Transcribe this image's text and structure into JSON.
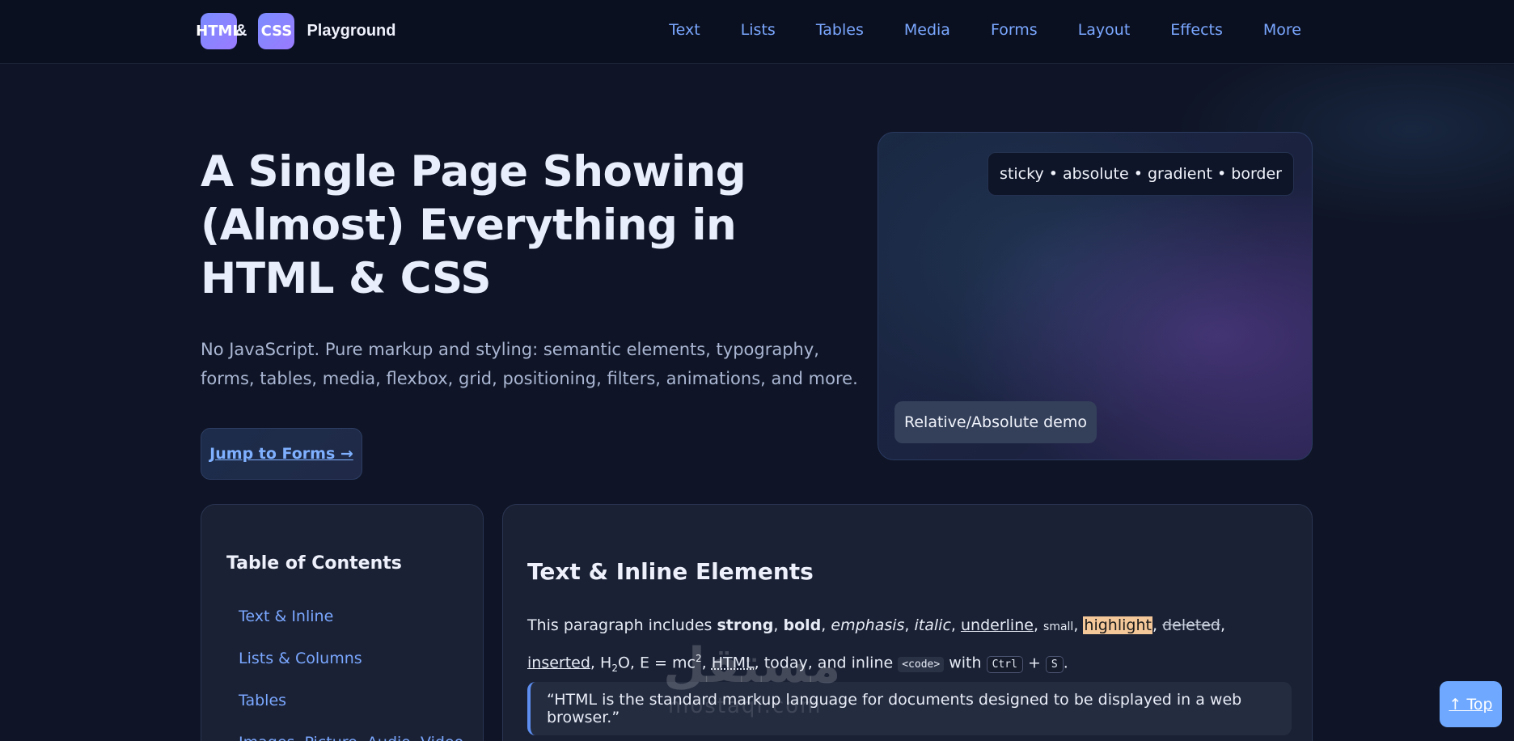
{
  "header": {
    "brand_chip_1": "HTML",
    "brand_amp": "&",
    "brand_chip_2": "CSS",
    "brand_title": "Playground",
    "nav": [
      "Text",
      "Lists",
      "Tables",
      "Media",
      "Forms",
      "Layout",
      "Effects",
      "More"
    ]
  },
  "hero": {
    "title": "A Single Page Showing (Almost) Everything in HTML & CSS",
    "subtitle": "No JavaScript. Pure markup and styling: semantic elements, typography, forms, tables, media, flexbox, grid, positioning, filters, animations, and more.",
    "cta": "Jump to Forms →",
    "demo_top_pill": "sticky • absolute • gradient • border",
    "demo_bottom_pill": "Relative/Absolute demo"
  },
  "toc": {
    "title": "Table of Contents",
    "items": [
      "Text & Inline",
      "Lists & Columns",
      "Tables",
      "Images, Picture, Audio, Video"
    ]
  },
  "content": {
    "heading": "Text & Inline Elements",
    "para": {
      "lead": "This paragraph includes ",
      "strong": "strong",
      "bold": "bold",
      "emphasis": "emphasis",
      "italic": "italic",
      "underline": "underline",
      "small": "small",
      "highlight": "highlight",
      "deleted": "deleted",
      "inserted": "inserted",
      "h2o_h": "H",
      "h2o_2": "2",
      "h2o_o": "O",
      "emc_e": "E = mc",
      "emc_2": "2",
      "abbr": "HTML",
      "today": "today",
      "inline_prefix": ", and inline ",
      "code": "<code>",
      "with": " with ",
      "kbd1": "Ctrl",
      "plus": " + ",
      "kbd2": "S"
    },
    "quote": "“HTML is the standard markup language for documents designed to be displayed in a web browser.”"
  },
  "back_to_top": "↑ Top",
  "watermark": {
    "main": "مستقل",
    "sub": "mostaql.com"
  }
}
